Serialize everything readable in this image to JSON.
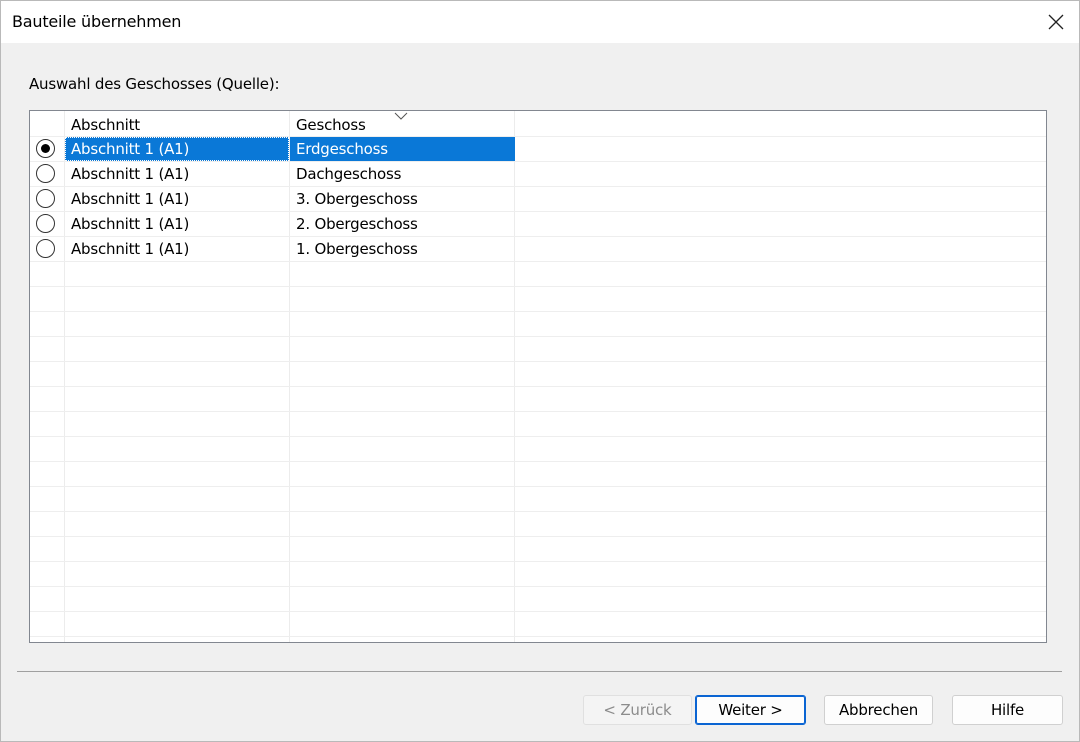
{
  "window": {
    "title": "Bauteile übernehmen"
  },
  "group": {
    "label": "Auswahl des Geschosses (Quelle):"
  },
  "table": {
    "columns": [
      "Abschnitt",
      "Geschoss"
    ],
    "sorted_column": "Geschoss",
    "rows": [
      {
        "abschnitt": "Abschnitt 1 (A1)",
        "geschoss": "Erdgeschoss",
        "selected": true
      },
      {
        "abschnitt": "Abschnitt 1 (A1)",
        "geschoss": "Dachgeschoss",
        "selected": false
      },
      {
        "abschnitt": "Abschnitt 1 (A1)",
        "geschoss": "3. Obergeschoss",
        "selected": false
      },
      {
        "abschnitt": "Abschnitt 1 (A1)",
        "geschoss": "2. Obergeschoss",
        "selected": false
      },
      {
        "abschnitt": "Abschnitt 1 (A1)",
        "geschoss": "1. Obergeschoss",
        "selected": false
      }
    ]
  },
  "buttons": {
    "back": "< Zurück",
    "next": "Weiter >",
    "cancel": "Abbrechen",
    "help": "Hilfe"
  },
  "colors": {
    "selection": "#0a78d7",
    "default_button_border": "#0a64d2"
  },
  "icons": {
    "close": "close-icon",
    "sort": "chevron-down-icon"
  }
}
